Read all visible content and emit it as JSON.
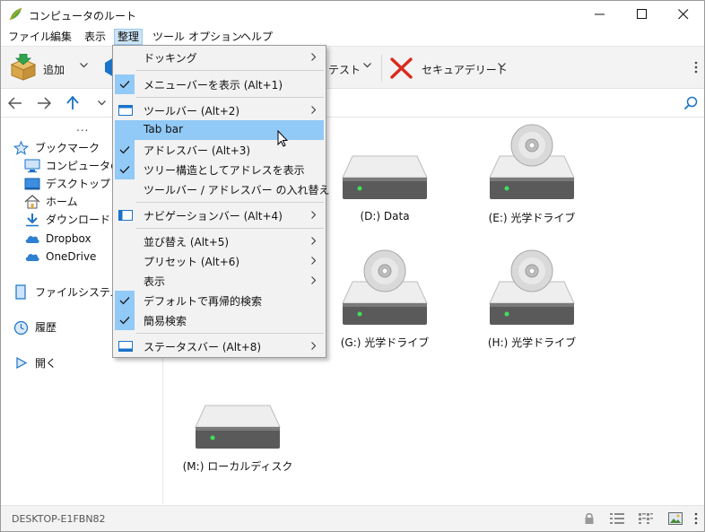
{
  "window": {
    "title": "コンピュータのルート"
  },
  "menubar": {
    "items": [
      {
        "label": "ファイル"
      },
      {
        "label": "編集"
      },
      {
        "label": "表示"
      },
      {
        "label": "整理"
      },
      {
        "label": "ツール"
      },
      {
        "label": "オプション"
      },
      {
        "label": "ヘルプ"
      }
    ]
  },
  "toolbar": {
    "add_label": "追加",
    "test_label": "テスト",
    "secure_delete_label": "セキュアデリート"
  },
  "sidebar": {
    "more": "...",
    "bookmarks_label": "ブックマーク",
    "items": [
      {
        "label": "コンピュータのルート"
      },
      {
        "label": "デスクトップ"
      },
      {
        "label": "ホーム"
      },
      {
        "label": "ダウンロード"
      },
      {
        "label": "Dropbox"
      },
      {
        "label": "OneDrive"
      }
    ],
    "filesystem_label": "ファイルシステム",
    "history_label": "履歴",
    "open_label": "開く"
  },
  "drives": [
    {
      "label": "(D:) Data",
      "type": "hdd"
    },
    {
      "label": "(E:) 光学ドライブ",
      "type": "optical"
    },
    {
      "label": "(G:) 光学ドライブ",
      "type": "optical"
    },
    {
      "label": "(H:) 光学ドライブ",
      "type": "optical"
    },
    {
      "label": "(M:) ローカルディスク",
      "type": "hdd"
    }
  ],
  "statusbar": {
    "computer_name": "DESKTOP-E1FBN82"
  },
  "dropdown": {
    "items": [
      {
        "label": "ドッキング",
        "checked": false,
        "submenu": true
      },
      {
        "label": "メニューバーを表示 (Alt+1)",
        "checked": true,
        "submenu": false
      },
      {
        "label": "ツールバー (Alt+2)",
        "checked": false,
        "submenu": true
      },
      {
        "label": "Tab bar",
        "checked": false,
        "submenu": false,
        "highlighted": true
      },
      {
        "label": "アドレスバー (Alt+3)",
        "checked": true,
        "submenu": false
      },
      {
        "label": "ツリー構造としてアドレスを表示",
        "checked": true,
        "submenu": false
      },
      {
        "label": "ツールバー / アドレスバー の入れ替え",
        "checked": false,
        "submenu": false
      },
      {
        "label": "ナビゲーションバー (Alt+4)",
        "checked": false,
        "submenu": true
      },
      {
        "label": "並び替え (Alt+5)",
        "checked": false,
        "submenu": true
      },
      {
        "label": "プリセット (Alt+6)",
        "checked": false,
        "submenu": true
      },
      {
        "label": "表示",
        "checked": false,
        "submenu": true
      },
      {
        "label": "デフォルトで再帰的検索",
        "checked": true,
        "submenu": false
      },
      {
        "label": "簡易検索",
        "checked": true,
        "submenu": false
      },
      {
        "label": "ステータスバー (Alt+8)",
        "checked": false,
        "submenu": true
      }
    ]
  },
  "colors": {
    "highlight": "#91c9f7",
    "menu_active": "#cce4f7",
    "accent_blue": "#1a73c9",
    "delete_red": "#d92b1e"
  }
}
